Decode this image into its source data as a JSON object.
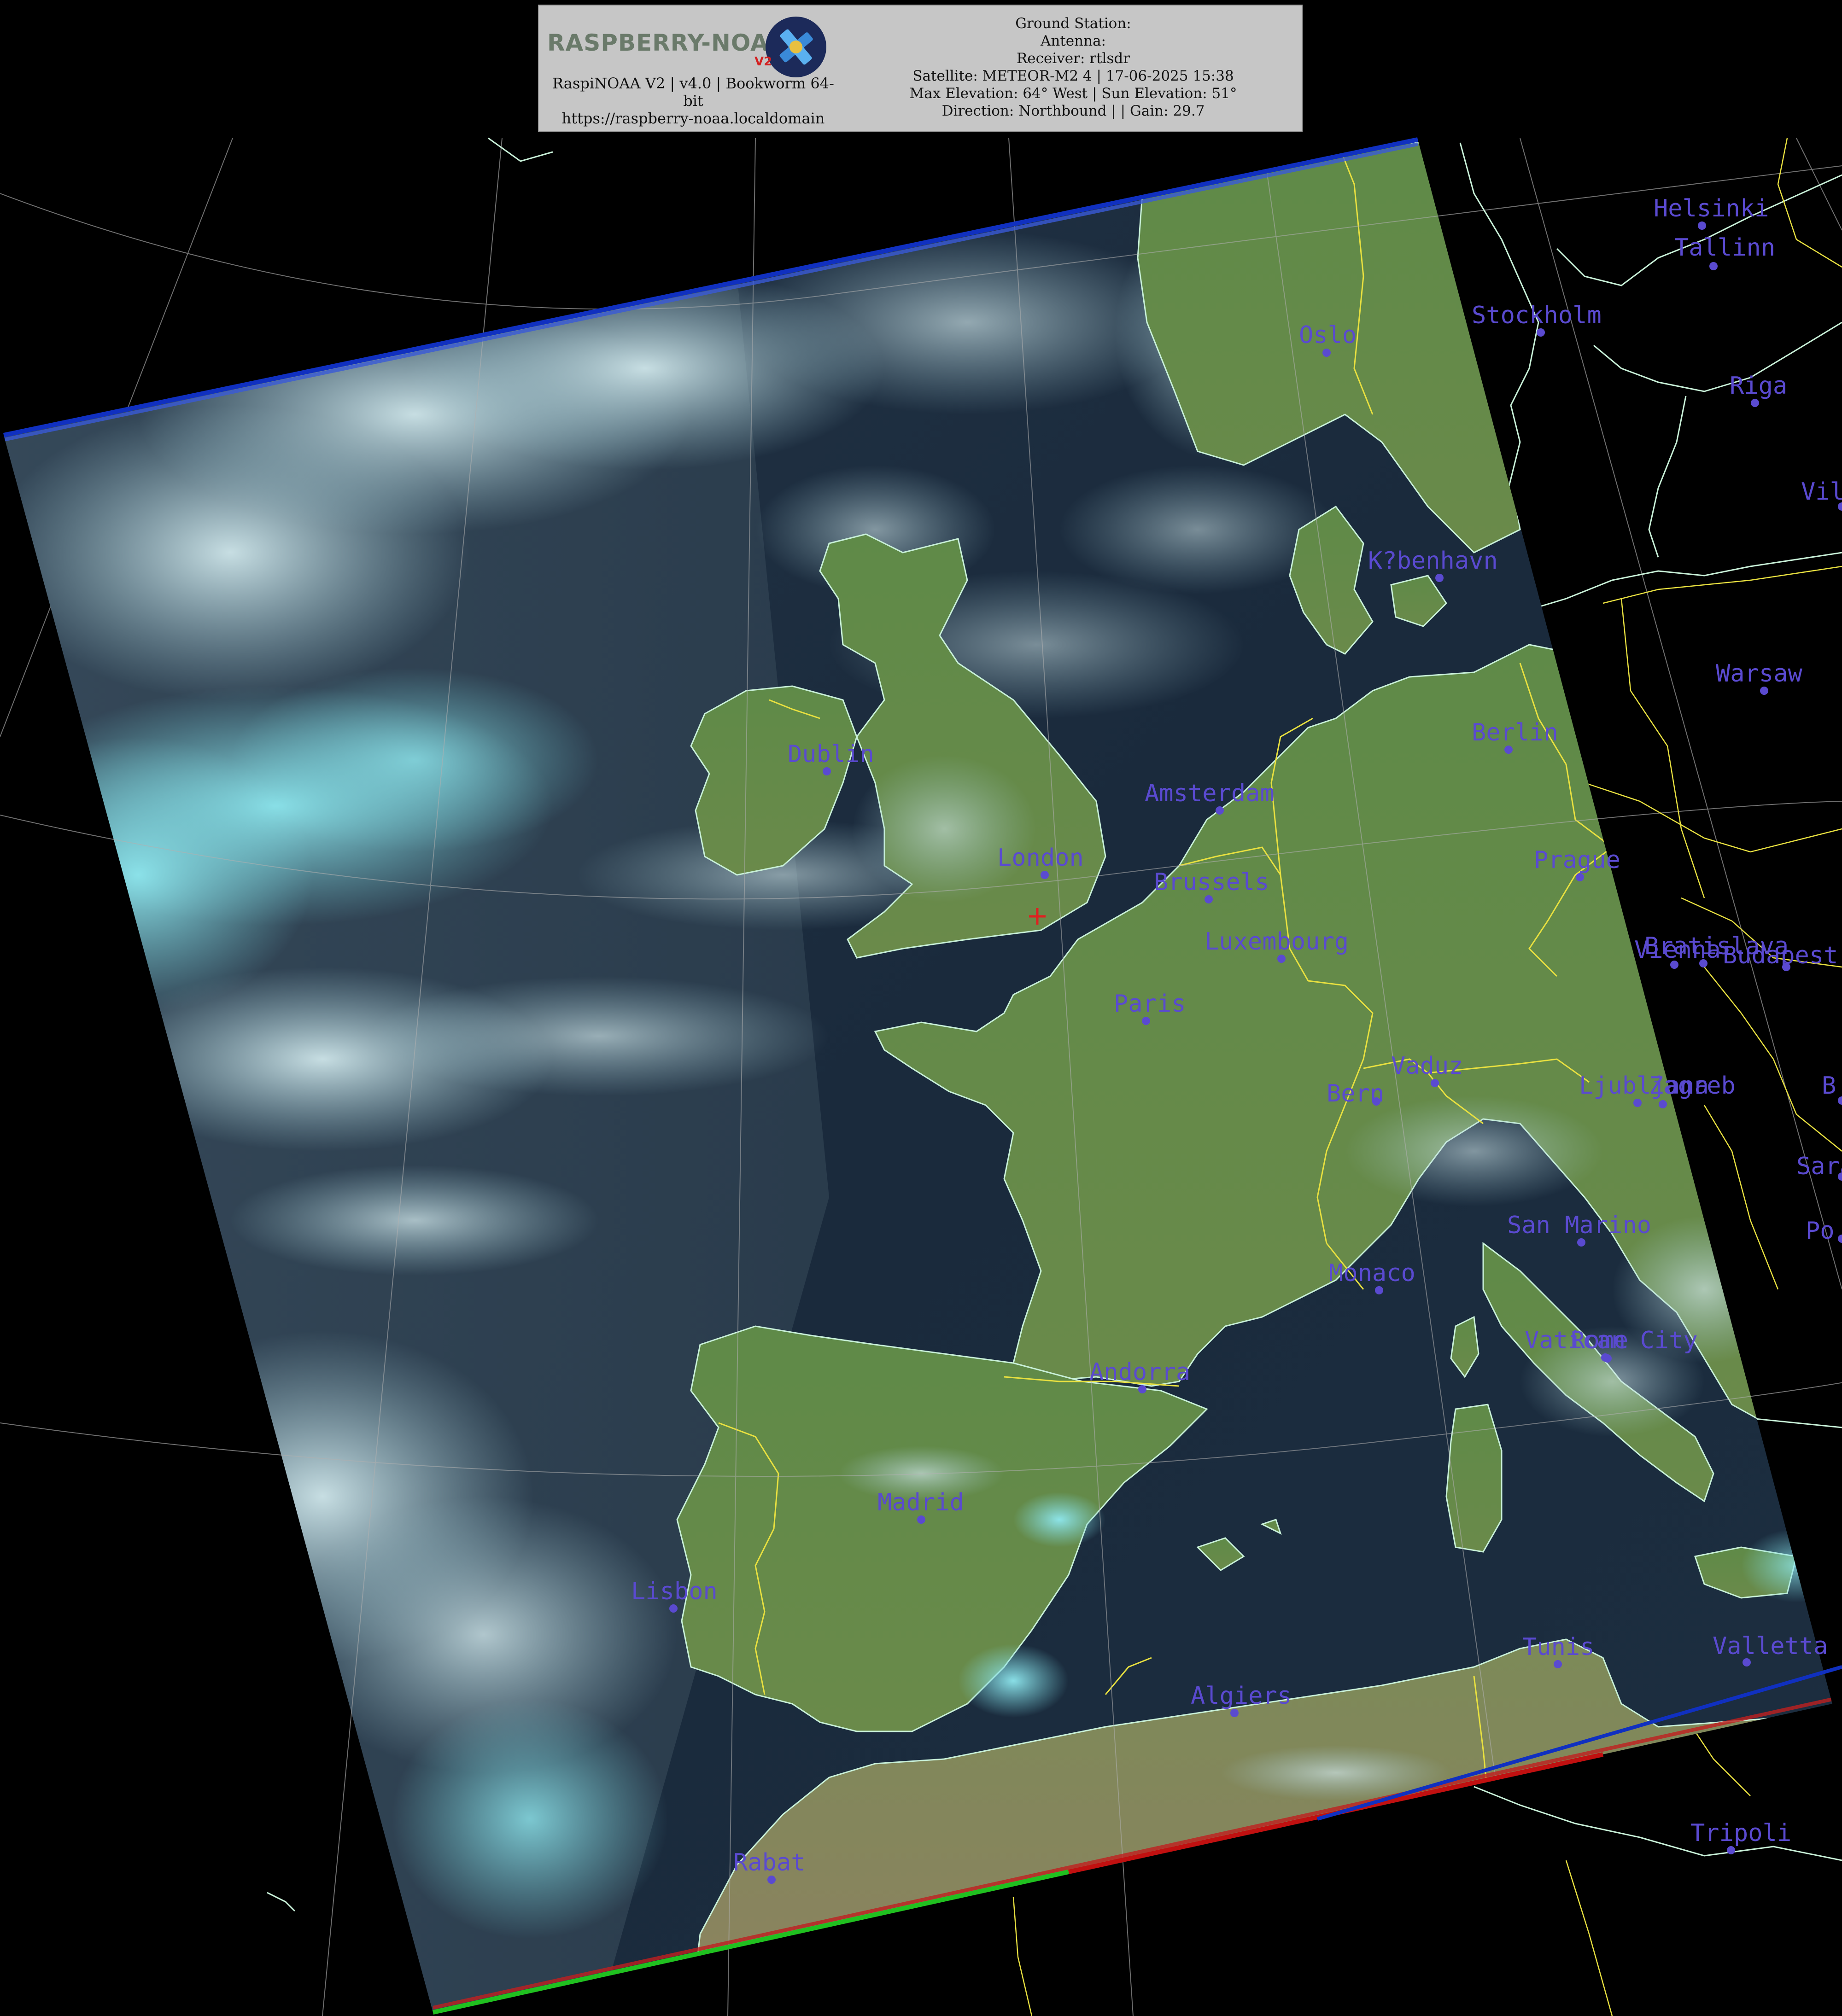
{
  "header": {
    "logo_text": "RASPBERRY-NOAA",
    "logo_badge": "V2",
    "left_line1": "RaspiNOAA V2 | v4.0 | Bookworm 64-",
    "left_line2": "bit",
    "left_line3": "https://raspberry-noaa.localdomain",
    "ground_station": "Ground Station:",
    "antenna": "Antenna:",
    "receiver": "Receiver: rtlsdr",
    "satellite": "Satellite: METEOR-M2 4 | 17-06-2025 15:38",
    "elevation": "Max Elevation: 64° West | Sun Elevation: 51°",
    "direction": "Direction: Northbound | | Gain: 29.7"
  },
  "cities": [
    {
      "name": "Helsinki"
    },
    {
      "name": "Tallinn"
    },
    {
      "name": "Stockholm"
    },
    {
      "name": "Oslo"
    },
    {
      "name": "Riga"
    },
    {
      "name": "Viln"
    },
    {
      "name": "K?benhavn"
    },
    {
      "name": "Warsaw"
    },
    {
      "name": "Berlin"
    },
    {
      "name": "Dublin"
    },
    {
      "name": "Amsterdam"
    },
    {
      "name": "London"
    },
    {
      "name": "Brussels"
    },
    {
      "name": "Prague"
    },
    {
      "name": "Luxembourg"
    },
    {
      "name": "Bratislava"
    },
    {
      "name": "Vienna"
    },
    {
      "name": "Budapest"
    },
    {
      "name": "Paris"
    },
    {
      "name": "Vaduz"
    },
    {
      "name": "Bern"
    },
    {
      "name": "Ljubljana"
    },
    {
      "name": "Zagreb"
    },
    {
      "name": "B"
    },
    {
      "name": "Saraje"
    },
    {
      "name": "Po"
    },
    {
      "name": "San Marino"
    },
    {
      "name": "Monaco"
    },
    {
      "name": "Vatican City"
    },
    {
      "name": "Rome"
    },
    {
      "name": "Andorra"
    },
    {
      "name": "Madrid"
    },
    {
      "name": "Lisbon"
    },
    {
      "name": "Tunis"
    },
    {
      "name": "Valletta"
    },
    {
      "name": "Algiers"
    },
    {
      "name": "Tripoli"
    },
    {
      "name": "Rabat"
    }
  ],
  "colors": {
    "city": "#5a4ad0",
    "border": "#e8e040",
    "coast": "#c8f0d8",
    "graticule": "#9a9a9a",
    "ocean": "#1b2a3a",
    "land": "#5e8a45"
  }
}
